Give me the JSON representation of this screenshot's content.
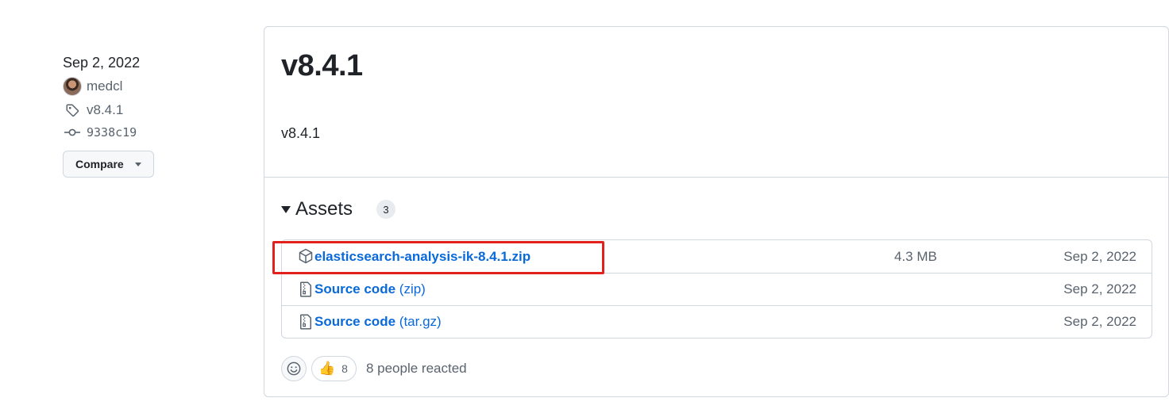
{
  "meta": {
    "date": "Sep 2, 2022",
    "author": "medcl",
    "tag": "v8.4.1",
    "commit": "9338c19",
    "compare_label": "Compare"
  },
  "release": {
    "title": "v8.4.1",
    "body": "v8.4.1"
  },
  "assets": {
    "label": "Assets",
    "count": "3",
    "items": [
      {
        "icon": "package-icon",
        "name": "elasticsearch-analysis-ik-8.4.1.zip",
        "ext": "",
        "size": "4.3 MB",
        "date": "Sep 2, 2022"
      },
      {
        "icon": "file-zip-icon",
        "name": "Source code",
        "ext": "(zip)",
        "size": "",
        "date": "Sep 2, 2022"
      },
      {
        "icon": "file-zip-icon",
        "name": "Source code",
        "ext": "(tar.gz)",
        "size": "",
        "date": "Sep 2, 2022"
      }
    ]
  },
  "reactions": {
    "emoji": "👍",
    "count": "8",
    "summary": "8 people reacted"
  },
  "colors": {
    "link": "#0969da",
    "highlight": "#e3211c",
    "border": "#d0d7de",
    "muted": "#59636e"
  }
}
